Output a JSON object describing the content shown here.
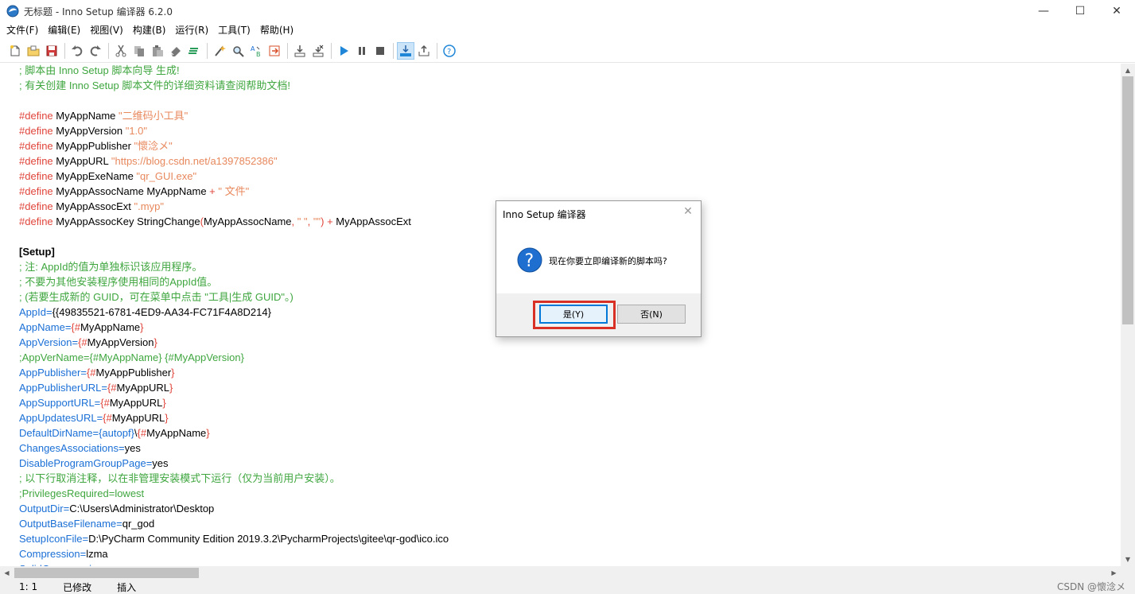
{
  "window": {
    "title": "无标题 - Inno Setup 编译器 6.2.0",
    "minimize": "—",
    "maximize": "☐",
    "close": "✕"
  },
  "menu": [
    "文件(F)",
    "编辑(E)",
    "视图(V)",
    "构建(B)",
    "运行(R)",
    "工具(T)",
    "帮助(H)"
  ],
  "toolbar": {
    "icons": [
      "new-file-icon",
      "open-icon",
      "save-icon",
      "undo-icon",
      "redo-icon",
      "cut-icon",
      "copy-icon",
      "paste-icon",
      "eraser-icon",
      "format-icon",
      "wizard-icon",
      "find-icon",
      "replace-icon",
      "goto-icon",
      "compile-icon",
      "stop-compile-icon",
      "run-icon",
      "pause-icon",
      "stop-icon",
      "target-icon",
      "upload-icon",
      "help-icon"
    ]
  },
  "editor": {
    "lines": [
      [
        {
          "t": "; 脚本由 Inno Setup 脚本向导 生成!",
          "c": "c"
        }
      ],
      [
        {
          "t": "; 有关创建 Inno Setup 脚本文件的详细资料请查阅帮助文档!",
          "c": "c"
        }
      ],
      [],
      [
        {
          "t": "#define",
          "c": "kw"
        },
        {
          "t": " MyAppName ",
          "c": ""
        },
        {
          "t": "\"二维码小工具\"",
          "c": "str"
        }
      ],
      [
        {
          "t": "#define",
          "c": "kw"
        },
        {
          "t": " MyAppVersion ",
          "c": ""
        },
        {
          "t": "\"1.0\"",
          "c": "str"
        }
      ],
      [
        {
          "t": "#define",
          "c": "kw"
        },
        {
          "t": " MyAppPublisher ",
          "c": ""
        },
        {
          "t": "\"懷淰メ\"",
          "c": "str"
        }
      ],
      [
        {
          "t": "#define",
          "c": "kw"
        },
        {
          "t": " MyAppURL ",
          "c": ""
        },
        {
          "t": "\"https://blog.csdn.net/a1397852386\"",
          "c": "str"
        }
      ],
      [
        {
          "t": "#define",
          "c": "kw"
        },
        {
          "t": " MyAppExeName ",
          "c": ""
        },
        {
          "t": "\"qr_GUI.exe\"",
          "c": "str"
        }
      ],
      [
        {
          "t": "#define",
          "c": "kw"
        },
        {
          "t": " MyAppAssocName MyAppName ",
          "c": ""
        },
        {
          "t": "+",
          "c": "kw"
        },
        {
          "t": " ",
          "c": ""
        },
        {
          "t": "\" 文件\"",
          "c": "str"
        }
      ],
      [
        {
          "t": "#define",
          "c": "kw"
        },
        {
          "t": " MyAppAssocExt ",
          "c": ""
        },
        {
          "t": "\".myp\"",
          "c": "str"
        }
      ],
      [
        {
          "t": "#define",
          "c": "kw"
        },
        {
          "t": " MyAppAssocKey StringChange",
          "c": ""
        },
        {
          "t": "(",
          "c": "kw"
        },
        {
          "t": "MyAppAssocName",
          "c": ""
        },
        {
          "t": ",",
          "c": "kw"
        },
        {
          "t": " ",
          "c": ""
        },
        {
          "t": "\" \"",
          "c": "str"
        },
        {
          "t": ", ",
          "c": "kw"
        },
        {
          "t": "\"\"",
          "c": "str"
        },
        {
          "t": ")",
          "c": "kw"
        },
        {
          "t": " ",
          "c": ""
        },
        {
          "t": "+",
          "c": "kw"
        },
        {
          "t": " MyAppAssocExt",
          "c": ""
        }
      ],
      [],
      [
        {
          "t": "[Setup]",
          "c": "sec"
        }
      ],
      [
        {
          "t": "; 注: AppId的值为单独标识该应用程序。",
          "c": "c"
        }
      ],
      [
        {
          "t": "; 不要为其他安装程序使用相同的AppId值。",
          "c": "c"
        }
      ],
      [
        {
          "t": "; (若要生成新的 GUID，可在菜单中点击 \"工具|生成 GUID\"。)",
          "c": "c"
        }
      ],
      [
        {
          "t": "AppId",
          "c": "key"
        },
        {
          "t": "=",
          "c": "key"
        },
        {
          "t": "{{49835521-6781-4ED9-AA34-FC71F4A8D214}",
          "c": ""
        }
      ],
      [
        {
          "t": "AppName",
          "c": "key"
        },
        {
          "t": "=",
          "c": "key"
        },
        {
          "t": "{#",
          "c": "sym"
        },
        {
          "t": "MyAppName",
          "c": ""
        },
        {
          "t": "}",
          "c": "sym"
        }
      ],
      [
        {
          "t": "AppVersion",
          "c": "key"
        },
        {
          "t": "=",
          "c": "key"
        },
        {
          "t": "{#",
          "c": "sym"
        },
        {
          "t": "MyAppVersion",
          "c": ""
        },
        {
          "t": "}",
          "c": "sym"
        }
      ],
      [
        {
          "t": ";AppVerName={#MyAppName} {#MyAppVersion}",
          "c": "c"
        }
      ],
      [
        {
          "t": "AppPublisher",
          "c": "key"
        },
        {
          "t": "=",
          "c": "key"
        },
        {
          "t": "{#",
          "c": "sym"
        },
        {
          "t": "MyAppPublisher",
          "c": ""
        },
        {
          "t": "}",
          "c": "sym"
        }
      ],
      [
        {
          "t": "AppPublisherURL",
          "c": "key"
        },
        {
          "t": "=",
          "c": "key"
        },
        {
          "t": "{#",
          "c": "sym"
        },
        {
          "t": "MyAppURL",
          "c": ""
        },
        {
          "t": "}",
          "c": "sym"
        }
      ],
      [
        {
          "t": "AppSupportURL",
          "c": "key"
        },
        {
          "t": "=",
          "c": "key"
        },
        {
          "t": "{#",
          "c": "sym"
        },
        {
          "t": "MyAppURL",
          "c": ""
        },
        {
          "t": "}",
          "c": "sym"
        }
      ],
      [
        {
          "t": "AppUpdatesURL",
          "c": "key"
        },
        {
          "t": "=",
          "c": "key"
        },
        {
          "t": "{#",
          "c": "sym"
        },
        {
          "t": "MyAppURL",
          "c": ""
        },
        {
          "t": "}",
          "c": "sym"
        }
      ],
      [
        {
          "t": "DefaultDirName",
          "c": "key"
        },
        {
          "t": "=",
          "c": "key"
        },
        {
          "t": "{autopf}",
          "c": "key"
        },
        {
          "t": "\\",
          "c": ""
        },
        {
          "t": "{#",
          "c": "sym"
        },
        {
          "t": "MyAppName",
          "c": ""
        },
        {
          "t": "}",
          "c": "sym"
        }
      ],
      [
        {
          "t": "ChangesAssociations",
          "c": "key"
        },
        {
          "t": "=",
          "c": "key"
        },
        {
          "t": "yes",
          "c": ""
        }
      ],
      [
        {
          "t": "DisableProgramGroupPage",
          "c": "key"
        },
        {
          "t": "=",
          "c": "key"
        },
        {
          "t": "yes",
          "c": ""
        }
      ],
      [
        {
          "t": "; 以下行取消注释，以在非管理安装模式下运行（仅为当前用户安装）。",
          "c": "c"
        }
      ],
      [
        {
          "t": ";PrivilegesRequired=lowest",
          "c": "c"
        }
      ],
      [
        {
          "t": "OutputDir",
          "c": "key"
        },
        {
          "t": "=",
          "c": "key"
        },
        {
          "t": "C:\\Users\\Administrator\\Desktop",
          "c": ""
        }
      ],
      [
        {
          "t": "OutputBaseFilename",
          "c": "key"
        },
        {
          "t": "=",
          "c": "key"
        },
        {
          "t": "qr_god",
          "c": ""
        }
      ],
      [
        {
          "t": "SetupIconFile",
          "c": "key"
        },
        {
          "t": "=",
          "c": "key"
        },
        {
          "t": "D:\\PyCharm Community Edition 2019.3.2\\PycharmProjects\\gitee\\qr-god\\ico.ico",
          "c": ""
        }
      ],
      [
        {
          "t": "Compression",
          "c": "key"
        },
        {
          "t": "=",
          "c": "key"
        },
        {
          "t": "lzma",
          "c": ""
        }
      ],
      [
        {
          "t": "SolidCompression",
          "c": "key"
        },
        {
          "t": "=",
          "c": "key"
        },
        {
          "t": "yes",
          "c": ""
        }
      ]
    ]
  },
  "status": {
    "position": "1:   1",
    "modified": "已修改",
    "mode": "插入",
    "watermark": "CSDN @懷淰メ"
  },
  "dialog": {
    "title": "Inno Setup 编译器",
    "close": "✕",
    "message": "现在你要立即编译新的脚本吗?",
    "yes_label": "是(Y)",
    "no_label": "否(N)"
  },
  "colors": {
    "comment": "#3fa63f",
    "directive": "#e0443a",
    "string": "#e8885d",
    "key": "#1a6fd6",
    "highlight_box": "#d93025",
    "accent": "#0078d7"
  }
}
